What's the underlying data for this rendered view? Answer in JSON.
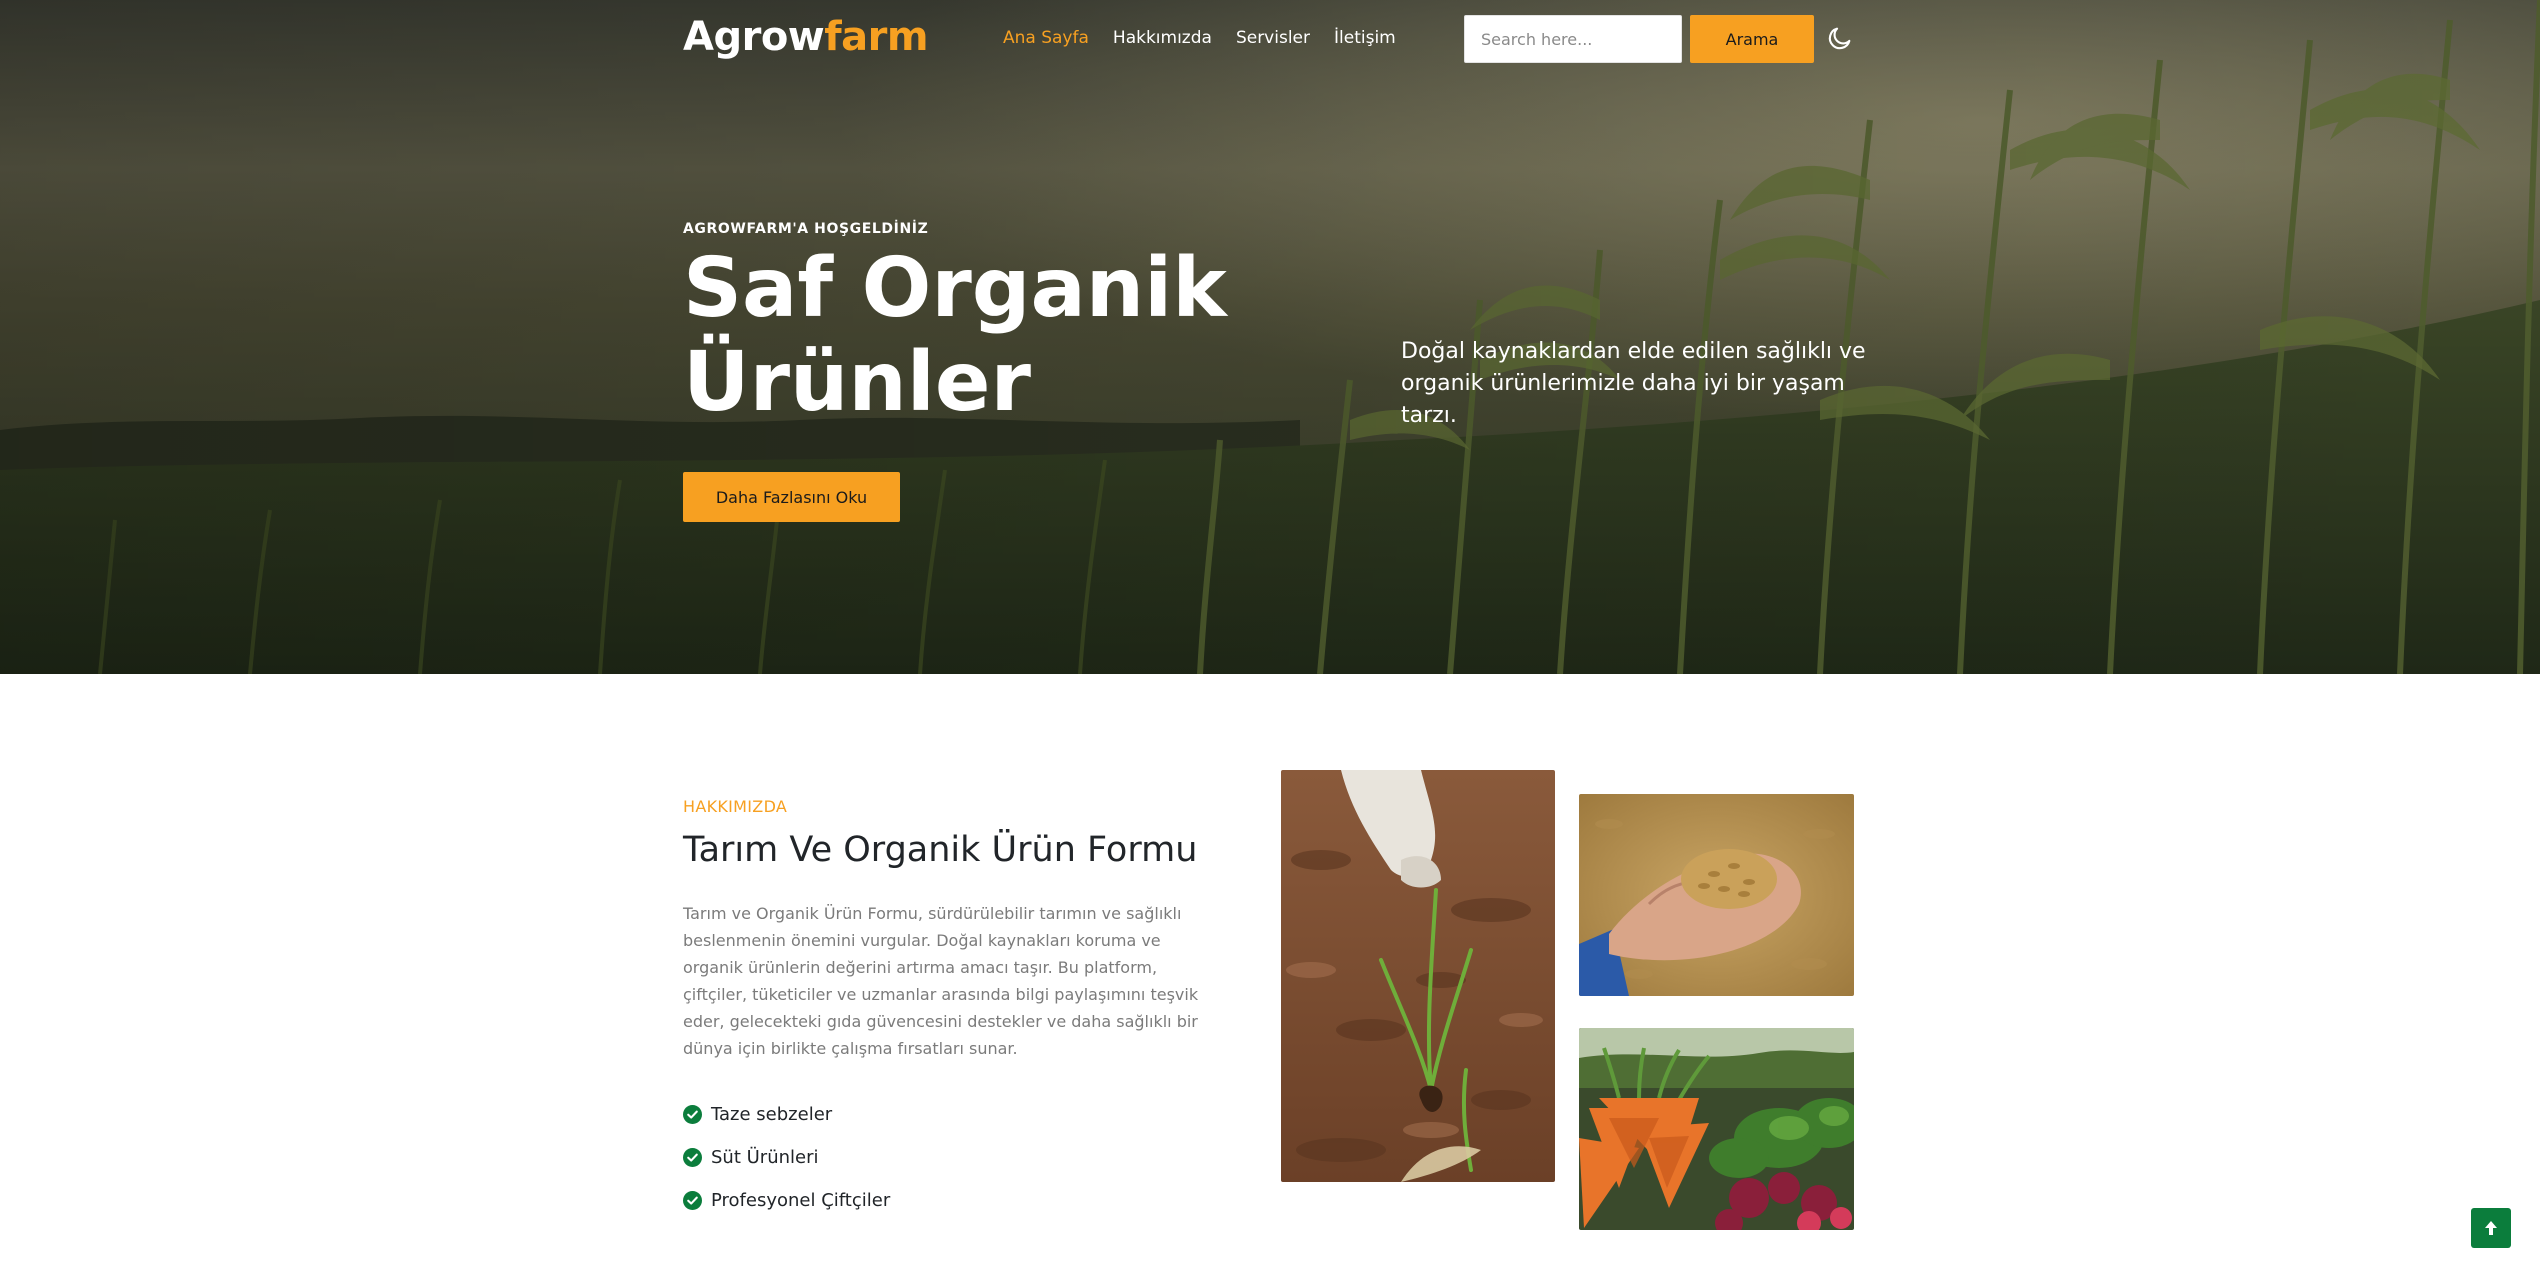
{
  "brand": {
    "part1": "Agrow",
    "part2": "farm"
  },
  "nav": {
    "items": [
      {
        "label": "Ana Sayfa",
        "active": true
      },
      {
        "label": "Hakkımızda",
        "active": false
      },
      {
        "label": "Servisler",
        "active": false
      },
      {
        "label": "İletişim",
        "active": false
      }
    ]
  },
  "search": {
    "placeholder": "Search here...",
    "button_label": "Arama"
  },
  "theme_toggle": {
    "icon": "moon-icon"
  },
  "hero": {
    "eyebrow": "AGROWFARM'A HOŞGELDİNİZ",
    "title_line1": "Saf Organik",
    "title_line2": "Ürünler",
    "cta_label": "Daha Fazlasını Oku",
    "description": "Doğal kaynaklardan elde edilen sağlıklı ve organik ürünlerimizle daha iyi bir yaşam tarzı."
  },
  "about": {
    "kicker": "HAKKIMIZDA",
    "title": "Tarım Ve Organik Ürün Formu",
    "text": "Tarım ve Organik Ürün Formu, sürdürülebilir tarımın ve sağlıklı beslenmenin önemini vurgular. Doğal kaynakları koruma ve organik ürünlerin değerini artırma amacı taşır. Bu platform, çiftçiler, tüketiciler ve uzmanlar arasında bilgi paylaşımını teşvik eder, gelecekteki gıda güvencesini destekler ve daha sağlıklı bir dünya için birlikte çalışma fırsatları sunar.",
    "features": [
      "Taze sebzeler",
      "Süt Ürünleri",
      "Profesyonel Çiftçiler"
    ]
  },
  "colors": {
    "accent": "#f7a021",
    "check": "#0b7d3c",
    "back_to_top": "#0b7d3c"
  },
  "icons": {
    "feature": "check-circle-icon",
    "back_to_top": "arrow-up-icon"
  }
}
